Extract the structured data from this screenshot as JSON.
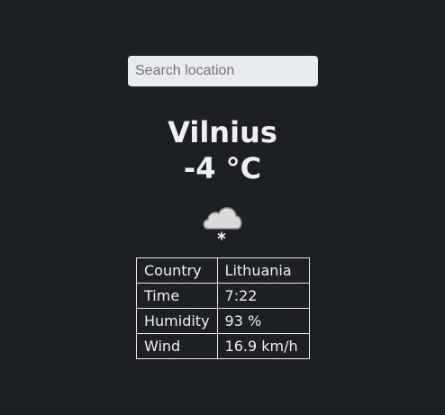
{
  "search": {
    "placeholder": "Search location",
    "value": ""
  },
  "location": {
    "city": "Vilnius",
    "temperature": "-4 °C",
    "condition_icon": "cloud-snow-icon"
  },
  "details": [
    {
      "label": "Country",
      "value": "Lithuania"
    },
    {
      "label": "Time",
      "value": "7:22"
    },
    {
      "label": "Humidity",
      "value": "93 %"
    },
    {
      "label": "Wind",
      "value": "16.9 km/h"
    }
  ],
  "colors": {
    "background": "#1c1f23",
    "text": "#eef0f2",
    "input_background": "#e8ebef",
    "table_border": "#e6e6e6"
  }
}
